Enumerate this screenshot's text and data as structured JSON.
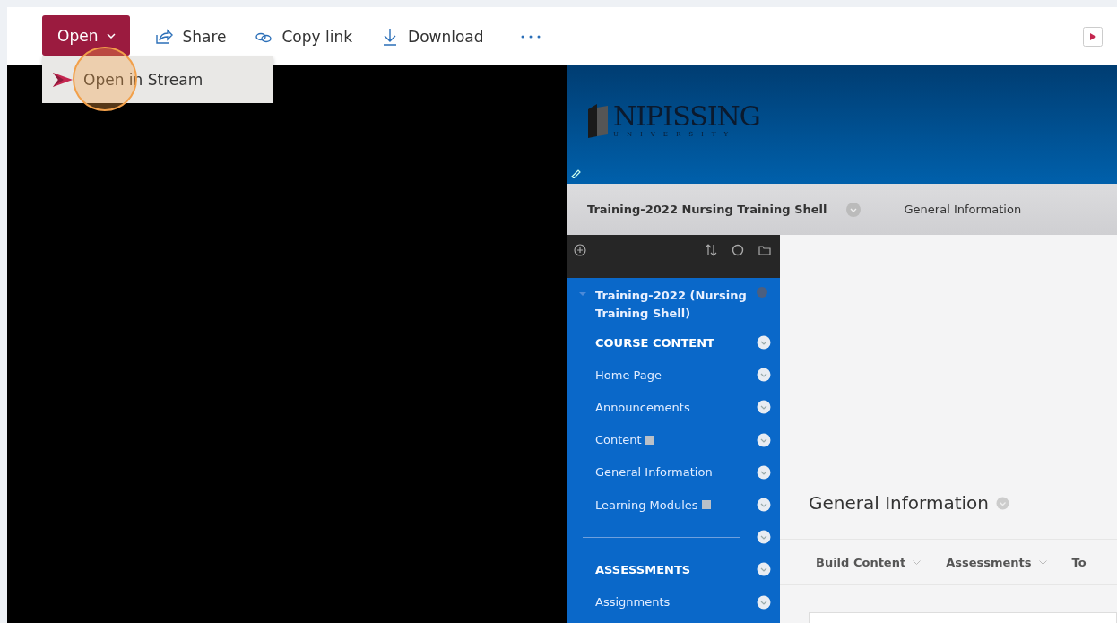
{
  "toolbar": {
    "open_button": {
      "label": "Open",
      "expanded": true
    },
    "actions": [
      {
        "label": "Share",
        "kind": "share"
      },
      {
        "label": "Copy link",
        "kind": "link"
      },
      {
        "label": "Download",
        "kind": "download"
      }
    ]
  },
  "dropdown": {
    "items": [
      {
        "label": "Open in Stream"
      }
    ]
  },
  "video": {
    "banner": {
      "logo": "NIPISSING",
      "logo_sub": "UNIVERSITY"
    },
    "breadcrumb": [
      "Training-2022 Nursing Training Shell",
      "General Information"
    ],
    "course_menu": {
      "course_title": "Training-2022 (Nursing Training Shell)",
      "items": [
        {
          "kind": "heading",
          "label": "COURSE CONTENT",
          "badge": false
        },
        {
          "kind": "link",
          "label": "Home Page",
          "badge": false
        },
        {
          "kind": "link",
          "label": "Announcements",
          "badge": false
        },
        {
          "kind": "link",
          "label": "Content",
          "badge": true
        },
        {
          "kind": "link",
          "label": "General Information",
          "badge": false
        },
        {
          "kind": "link",
          "label": "Learning Modules",
          "badge": true
        },
        {
          "kind": "divider"
        },
        {
          "kind": "heading",
          "label": "ASSESSMENTS",
          "badge": false
        },
        {
          "kind": "link",
          "label": "Assignments",
          "badge": false
        }
      ]
    },
    "page": {
      "title": "General Information",
      "action_menus": [
        "Build Content",
        "Assessments",
        "To"
      ]
    }
  }
}
